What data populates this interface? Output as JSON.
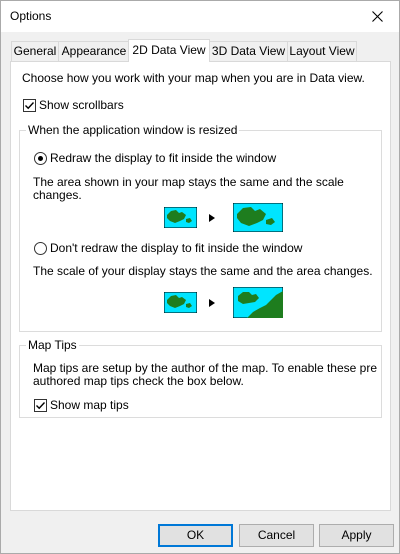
{
  "window": {
    "title": "Options"
  },
  "tabs": [
    "General",
    "Appearance",
    "2D Data View",
    "3D Data View",
    "Layout View"
  ],
  "active_tab": "2D Data View",
  "intro_text": "Choose how you work with your map when you are in Data view.",
  "show_scrollbars": {
    "label": "Show scrollbars",
    "checked": true
  },
  "resize_group": {
    "legend": "When the application window is resized",
    "option_redraw": {
      "label": "Redraw the display to fit inside the window",
      "selected": true,
      "description_line1": "The area shown in your map stays the same and the scale",
      "description_line2": "changes."
    },
    "option_no_redraw": {
      "label": "Don't redraw the display to fit inside the window",
      "selected": false,
      "description": "The scale of your display stays the same and the area changes."
    }
  },
  "map_tips_group": {
    "legend": "Map Tips",
    "text_line1": "Map tips are setup by the author of the map.  To enable these pre",
    "text_line2": "authored map tips check the box below.",
    "checkbox": {
      "label": "Show map tips",
      "checked": true
    }
  },
  "buttons": {
    "ok": "OK",
    "cancel": "Cancel",
    "apply": "Apply"
  },
  "colors": {
    "water": "#00e5ff",
    "land": "#1e7d1e",
    "accent": "#0078d7"
  }
}
